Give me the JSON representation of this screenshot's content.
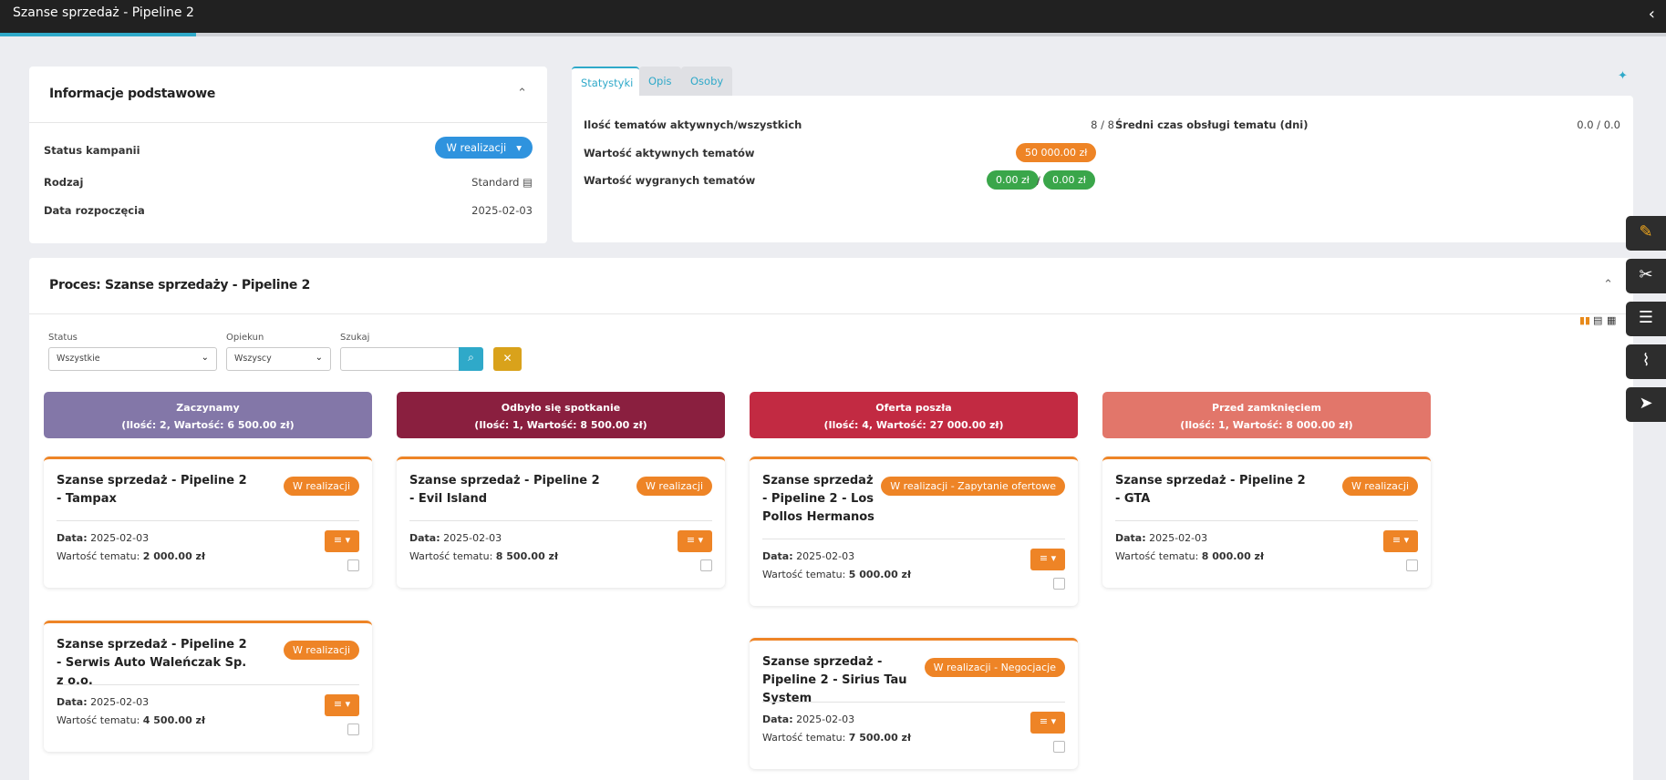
{
  "topbar": {
    "title": "Szanse sprzedaż - Pipeline 2",
    "back_icon": "‹",
    "progress_percent": 12
  },
  "info": {
    "title": "Informacje podstawowe",
    "collapse_icon": "⌃",
    "rows": [
      {
        "label": "Status kampanii",
        "value": "W realizacji"
      },
      {
        "label": "Rodzaj",
        "value": "Standard"
      },
      {
        "label": "Data rozpoczęcia",
        "value": "2025-02-03"
      }
    ]
  },
  "tabs": [
    "Statystyki",
    "Opis",
    "Osoby"
  ],
  "stats": {
    "active_total_label": "Ilość tematów aktywnych/wszystkich",
    "active_total_value": "8 / 8",
    "active_value_label": "Wartość aktywnych tematów",
    "active_value": "50 000.00 zł",
    "won_label": "Wartość wygranych tematów",
    "won_value_a": "0.00 zł",
    "won_sep": "/",
    "won_value_b": "0.00 zł",
    "avg_label": "Średni czas obsługi tematu (dni)",
    "avg_value": "0.0 / 0.0"
  },
  "process": {
    "title": "Proces: Szanse sprzedaży - Pipeline 2",
    "filters": {
      "status_label": "Status",
      "status_value": "Wszystkie",
      "owner_label": "Opiekun",
      "owner_value": "Wszyscy",
      "search_label": "Szukaj",
      "search_value": ""
    },
    "columns": [
      {
        "name": "Zaczynamy",
        "summary": "(Ilość: 2, Wartość: 6 500.00 zł)",
        "color": "#8377a8"
      },
      {
        "name": "Odbyło się spotkanie",
        "summary": "(Ilość: 1, Wartość: 8 500.00 zł)",
        "color": "#8a1f3f"
      },
      {
        "name": "Oferta poszła",
        "summary": "(Ilość: 4, Wartość: 27 000.00 zł)",
        "color": "#c22a42"
      },
      {
        "name": "Przed zamknięciem",
        "summary": "(Ilość: 1, Wartość: 8 000.00 zł)",
        "color": "#e2766a"
      }
    ],
    "deals": [
      {
        "title": "Szanse sprzedaż - Pipeline 2 - Tampax",
        "status": "W realizacji",
        "date_label": "Data:",
        "date": "2025-02-03",
        "value_label": "Wartość tematu:",
        "value": "2 000.00 zł"
      },
      {
        "title": "Szanse sprzedaż - Pipeline 2 - Serwis Auto Waleńczak Sp. z o.o.",
        "status": "W realizacji",
        "date_label": "Data:",
        "date": "2025-02-03",
        "value_label": "Wartość tematu:",
        "value": "4 500.00 zł"
      },
      {
        "title": "Szanse sprzedaż - Pipeline 2 - Evil Island",
        "status": "W realizacji",
        "date_label": "Data:",
        "date": "2025-02-03",
        "value_label": "Wartość tematu:",
        "value": "8 500.00 zł"
      },
      {
        "title": "Szanse sprzedaż - Pipeline 2 - Los Pollos Hermanos",
        "status": "W realizacji - Zapytanie ofertowe",
        "date_label": "Data:",
        "date": "2025-02-03",
        "value_label": "Wartość tematu:",
        "value": "5 000.00 zł"
      },
      {
        "title": "Szanse sprzedaż - Pipeline 2 - Sirius Tau System",
        "status": "W realizacji - Negocjacje",
        "date_label": "Data:",
        "date": "2025-02-03",
        "value_label": "Wartość tematu:",
        "value": "7 500.00 zł"
      },
      {
        "title": "Szanse sprzedaż - Pipeline 2 - GTA",
        "status": "W realizacji",
        "date_label": "Data:",
        "date": "2025-02-03",
        "value_label": "Wartość tematu:",
        "value": "8 000.00 zł"
      }
    ]
  },
  "side_icons": [
    "edit-icon",
    "tools-icon",
    "filter-list-icon",
    "paperclip-icon",
    "send-icon"
  ]
}
